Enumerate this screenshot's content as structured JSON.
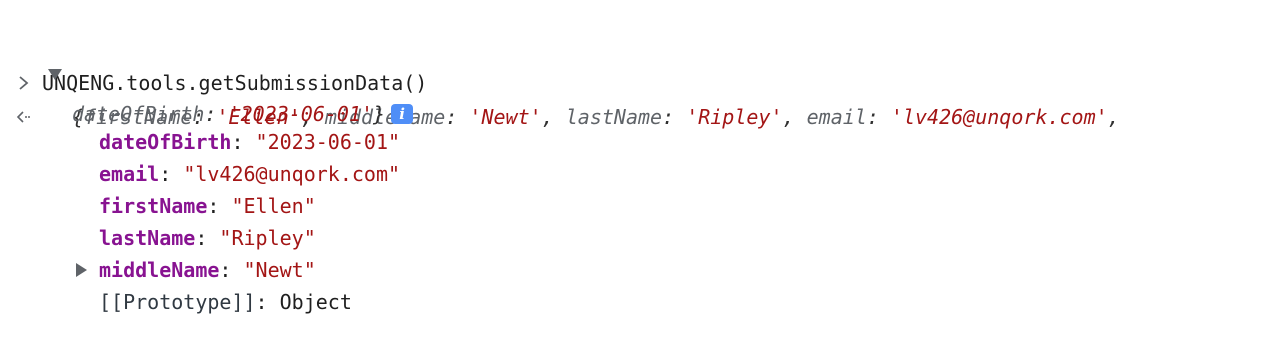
{
  "console": {
    "input": {
      "prompt_icon": "chevron-right-icon",
      "command": "UNQENG.tools.getSubmissionData()"
    },
    "result": {
      "return_icon": "return-arrow-icon",
      "preview": {
        "open_brace": "{",
        "k1": "firstName",
        "v1": "'Ellen'",
        "k2": "middleName",
        "v2": "'Newt'",
        "k3": "lastName",
        "v3": "'Ripley'",
        "k4": "email",
        "v4": "'lv426@unqork.com'",
        "k5": "dateOfBirth",
        "v5": "'2023-06-01'",
        "close_brace": "}"
      },
      "info_badge": "i",
      "properties": [
        {
          "key": "dateOfBirth",
          "value": "\"2023-06-01\""
        },
        {
          "key": "email",
          "value": "\"lv426@unqork.com\""
        },
        {
          "key": "firstName",
          "value": "\"Ellen\""
        },
        {
          "key": "lastName",
          "value": "\"Ripley\""
        },
        {
          "key": "middleName",
          "value": "\"Newt\""
        }
      ],
      "prototype": {
        "key": "[[Prototype]]",
        "value": "Object"
      }
    }
  },
  "colors": {
    "property_key": "#881391",
    "string_value": "#a31515",
    "preview_key": "#5f6368",
    "info_badge": "#4f8ef7"
  }
}
